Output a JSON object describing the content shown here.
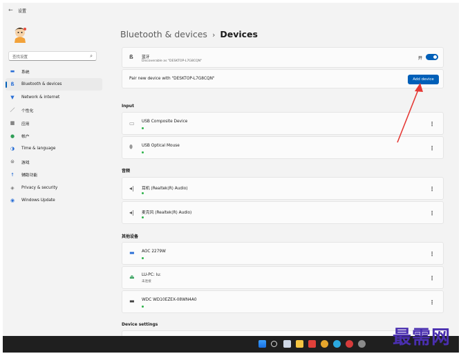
{
  "app": {
    "title": "设置"
  },
  "sidebar": {
    "search_placeholder": "查找设置",
    "items": [
      {
        "label": "系统",
        "icon": "monitor-icon"
      },
      {
        "label": "Bluetooth & devices",
        "icon": "bluetooth-icon"
      },
      {
        "label": "Network & internet",
        "icon": "wifi-icon"
      },
      {
        "label": "个性化",
        "icon": "pen-icon"
      },
      {
        "label": "应用",
        "icon": "apps-icon"
      },
      {
        "label": "帐户",
        "icon": "person-icon"
      },
      {
        "label": "Time & language",
        "icon": "globe-icon"
      },
      {
        "label": "游戏",
        "icon": "gamepad-icon"
      },
      {
        "label": "辅助功能",
        "icon": "accessibility-icon"
      },
      {
        "label": "Privacy & security",
        "icon": "shield-icon"
      },
      {
        "label": "Windows Update",
        "icon": "update-icon"
      }
    ]
  },
  "breadcrumb": {
    "parent": "Bluetooth & devices",
    "separator": "›",
    "current": "Devices"
  },
  "bluetooth": {
    "name": "蓝牙",
    "discoverable": "Discoverable as \"DESKTOP-L7G8CQN\"",
    "toggle_label": "开",
    "toggle_on": true
  },
  "pair": {
    "text": "Pair new device with \"DESKTOP-L7G8CQN\"",
    "button": "Add device"
  },
  "sections": {
    "input": "Input",
    "audio": "音频",
    "other": "其他设备",
    "settings": "Device settings"
  },
  "input_devices": [
    {
      "name": "USB Composite Device",
      "icon": "keyboard-icon"
    },
    {
      "name": "USB Optical Mouse",
      "icon": "mouse-icon"
    }
  ],
  "audio_devices": [
    {
      "name": "耳机 (Realtek(R) Audio)",
      "icon": "speaker-icon"
    },
    {
      "name": "麦克风 (Realtek(R) Audio)",
      "icon": "speaker-icon"
    }
  ],
  "other_devices": [
    {
      "name": "AOC 2279W",
      "sub": "",
      "icon": "display-icon"
    },
    {
      "name": "LU-PC: lu:",
      "sub": "未连接",
      "icon": "media-server-icon"
    },
    {
      "name": "WDC WD10EZEX-08WN4A0",
      "sub": "",
      "icon": "drive-icon"
    }
  ],
  "colors": {
    "accent": "#005fb8",
    "status_green": "#2db34a",
    "watermark": "#4a2fb0",
    "arrow": "#e53935"
  },
  "watermark": "最需网"
}
